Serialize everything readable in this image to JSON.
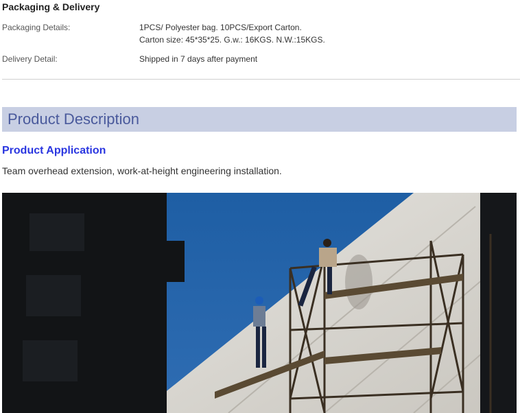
{
  "packaging": {
    "heading": "Packaging & Delivery",
    "packaging_label": "Packaging Details:",
    "packaging_line1": "1PCS/ Polyester bag. 10PCS/Export Carton.",
    "packaging_line2": "Carton size: 45*35*25. G.w.: 16KGS. N.W.:15KGS.",
    "delivery_label": "Delivery Detail:",
    "delivery_value": "Shipped in 7 days after payment"
  },
  "description": {
    "bar_title": "Product Description",
    "app_heading": "Product Application",
    "app_text": "Team overhead extension, work-at-height engineering installation."
  },
  "colors": {
    "bar_background": "#c8cfe3",
    "bar_text": "#4a5a9c",
    "heading_blue": "#2a36e0"
  }
}
